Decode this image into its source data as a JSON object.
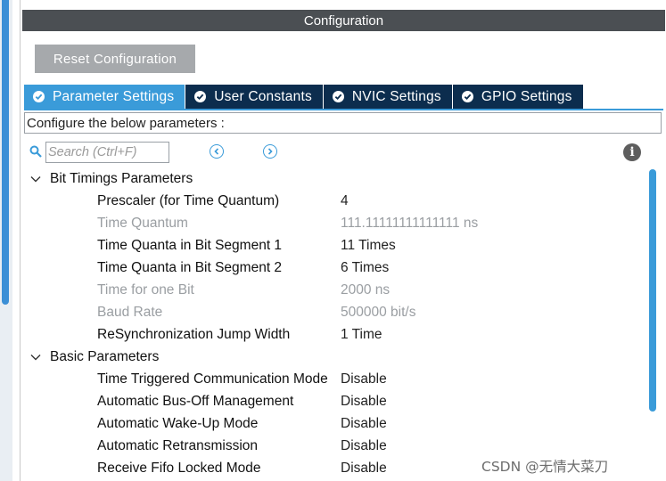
{
  "panel": {
    "title": "Configuration"
  },
  "toolbar": {
    "reset_label": "Reset Configuration"
  },
  "tabs": [
    {
      "label": "Parameter Settings",
      "active": true
    },
    {
      "label": "User Constants",
      "active": false
    },
    {
      "label": "NVIC Settings",
      "active": false
    },
    {
      "label": "GPIO Settings",
      "active": false
    }
  ],
  "instructions": "Configure the below parameters :",
  "search": {
    "placeholder": "Search (Ctrl+F)"
  },
  "groups": [
    {
      "title": "Bit Timings Parameters",
      "rows": [
        {
          "name": "Prescaler (for Time Quantum)",
          "value": "4",
          "readonly": false
        },
        {
          "name": "Time Quantum",
          "value": "111.11111111111111 ns",
          "readonly": true
        },
        {
          "name": "Time Quanta in Bit Segment 1",
          "value": "11 Times",
          "readonly": false
        },
        {
          "name": "Time Quanta in Bit Segment 2",
          "value": "6 Times",
          "readonly": false
        },
        {
          "name": "Time for one Bit",
          "value": "2000 ns",
          "readonly": true
        },
        {
          "name": "Baud Rate",
          "value": "500000 bit/s",
          "readonly": true
        },
        {
          "name": "ReSynchronization Jump Width",
          "value": "1 Time",
          "readonly": false
        }
      ]
    },
    {
      "title": "Basic Parameters",
      "rows": [
        {
          "name": "Time Triggered Communication Mode",
          "value": "Disable",
          "readonly": false
        },
        {
          "name": "Automatic Bus-Off Management",
          "value": "Disable",
          "readonly": false
        },
        {
          "name": "Automatic Wake-Up Mode",
          "value": "Disable",
          "readonly": false
        },
        {
          "name": "Automatic Retransmission",
          "value": "Disable",
          "readonly": false
        },
        {
          "name": "Receive Fifo Locked Mode",
          "value": "Disable",
          "readonly": false
        }
      ]
    }
  ],
  "watermark": "CSDN @无情大菜刀",
  "colors": {
    "title_bar": "#4b4f53",
    "tab_active": "#3a9bd9",
    "tab_inactive": "#0c2d4e",
    "reset_button": "#a6a9ac",
    "readonly_text": "#9a9ea2"
  },
  "icons": {
    "tab_status": "check-circle-icon",
    "search": "search-icon",
    "prev": "chevron-left-circle-icon",
    "next": "chevron-right-circle-icon",
    "info": "info-icon",
    "group_toggle": "chevron-down-icon"
  }
}
